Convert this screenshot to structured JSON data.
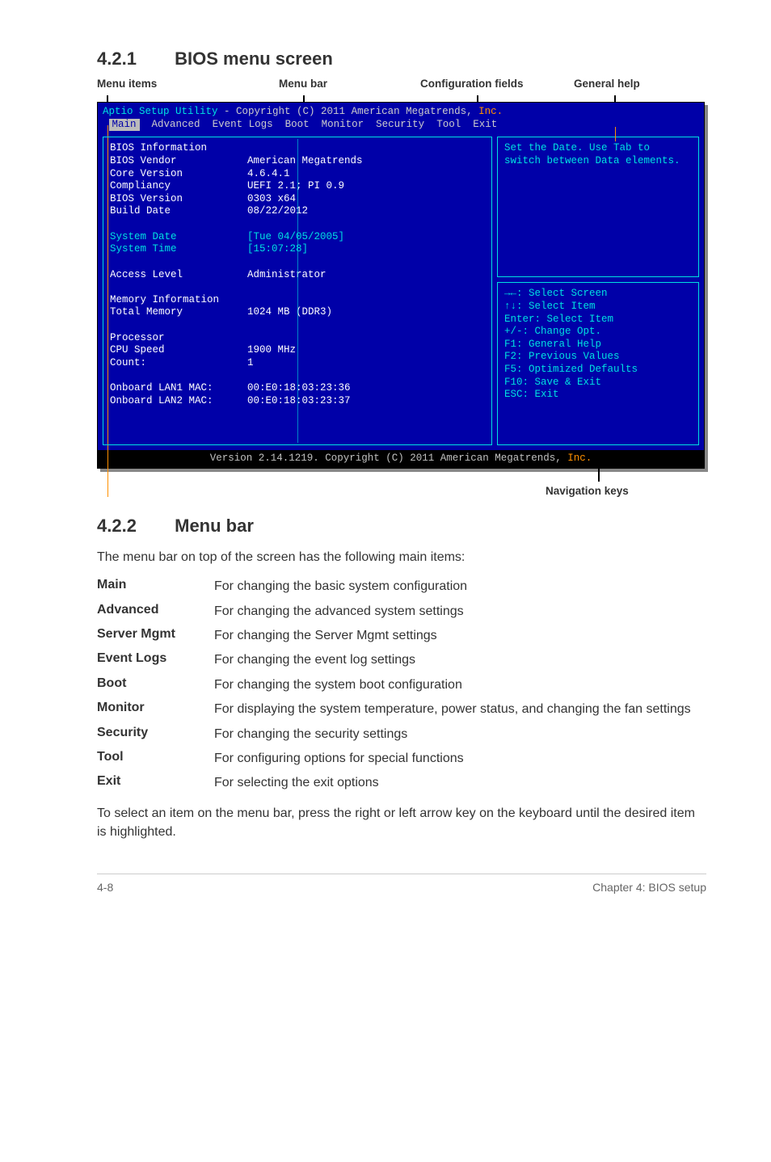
{
  "section1": {
    "number": "4.2.1",
    "title": "BIOS menu screen"
  },
  "labels": {
    "menu_items": "Menu items",
    "menu_bar": "Menu bar",
    "config_fields": "Configuration fields",
    "general_help": "General help",
    "nav_keys": "Navigation keys"
  },
  "bios": {
    "title_left": "Aptio Setup Utility ",
    "title_mid": "- Copyright (C) 2011 ",
    "title_mid2": "American Megatrends, ",
    "title_inc": "Inc.",
    "tabs": [
      "Main",
      "Advanced",
      "Event Logs",
      "Boot",
      "Monitor",
      "Security",
      "Tool",
      "Exit"
    ],
    "fields": [
      {
        "k": "BIOS Information",
        "v": ""
      },
      {
        "k": "BIOS Vendor",
        "v": "American Megatrends"
      },
      {
        "k": "Core Version",
        "v": "4.6.4.1"
      },
      {
        "k": "Compliancy",
        "v": "UEFI 2.1; PI 0.9"
      },
      {
        "k": "BIOS Version",
        "v": "0303 x64"
      },
      {
        "k": "Build Date",
        "v": "08/22/2012"
      }
    ],
    "date_time": [
      {
        "k": "System Date",
        "v": "[Tue 04/05/2005]"
      },
      {
        "k": "System Time",
        "v": "[15:07:28]"
      }
    ],
    "access": {
      "k": "Access Level",
      "v": "Administrator"
    },
    "mem": [
      {
        "k": "Memory Information",
        "v": ""
      },
      {
        "k": "Total Memory",
        "v": "1024 MB (DDR3)"
      }
    ],
    "cpu": [
      {
        "k": "Processor",
        "v": ""
      },
      {
        "k": "CPU Speed",
        "v": "1900 MHz"
      },
      {
        "k": "Count:",
        "v": "1"
      }
    ],
    "mac": [
      {
        "k": "Onboard LAN1 MAC:",
        "v": "00:E0:18:03:23:36"
      },
      {
        "k": "Onboard LAN2 MAC:",
        "v": "00:E0:18:03:23:37"
      }
    ],
    "help_top": "Set the Date. Use Tab to switch between Data elements.",
    "nav": [
      "→←: Select Screen",
      "↑↓:  Select Item",
      "Enter: Select Item",
      "+/-: Change Opt.",
      "F1: General Help",
      "F2: Previous Values",
      "F5: Optimized Defaults",
      "F10: Save & Exit",
      "ESC: Exit"
    ],
    "footer_left": "Version 2.14.1219. Copyright (C) 2011 American Megatrends, ",
    "footer_inc": "Inc."
  },
  "section2": {
    "number": "4.2.2",
    "title": "Menu bar"
  },
  "intro2": "The menu bar on top of the screen has the following main items:",
  "defs": [
    {
      "term": "Main",
      "def": "For changing the basic system configuration"
    },
    {
      "term": "Advanced",
      "def": "For changing the advanced system settings"
    },
    {
      "term": "Server Mgmt",
      "def": "For changing the Server Mgmt settings"
    },
    {
      "term": "Event Logs",
      "def": "For changing the event log settings"
    },
    {
      "term": "Boot",
      "def": "For changing the system boot configuration"
    },
    {
      "term": "Monitor",
      "def": "For displaying the system temperature, power status, and changing the fan settings"
    },
    {
      "term": "Security",
      "def": "For changing the security settings"
    },
    {
      "term": "Tool",
      "def": "For configuring options for special functions"
    },
    {
      "term": "Exit",
      "def": "For selecting the exit options"
    }
  ],
  "outro2": "To select an item on the menu bar, press the right or left arrow key on the keyboard until the desired item is highlighted.",
  "chart_data": {
    "type": "table",
    "title": "BIOS Information (Main tab)",
    "rows": [
      [
        "BIOS Vendor",
        "American Megatrends"
      ],
      [
        "Core Version",
        "4.6.4.1"
      ],
      [
        "Compliancy",
        "UEFI 2.1; PI 0.9"
      ],
      [
        "BIOS Version",
        "0303 x64"
      ],
      [
        "Build Date",
        "08/22/2012"
      ],
      [
        "System Date",
        "[Tue 04/05/2005]"
      ],
      [
        "System Time",
        "[15:07:28]"
      ],
      [
        "Access Level",
        "Administrator"
      ],
      [
        "Total Memory",
        "1024 MB (DDR3)"
      ],
      [
        "CPU Speed",
        "1900 MHz"
      ],
      [
        "Count",
        "1"
      ],
      [
        "Onboard LAN1 MAC",
        "00:E0:18:03:23:36"
      ],
      [
        "Onboard LAN2 MAC",
        "00:E0:18:03:23:37"
      ]
    ]
  },
  "footer": {
    "left": "4-8",
    "right": "Chapter 4: BIOS setup"
  }
}
